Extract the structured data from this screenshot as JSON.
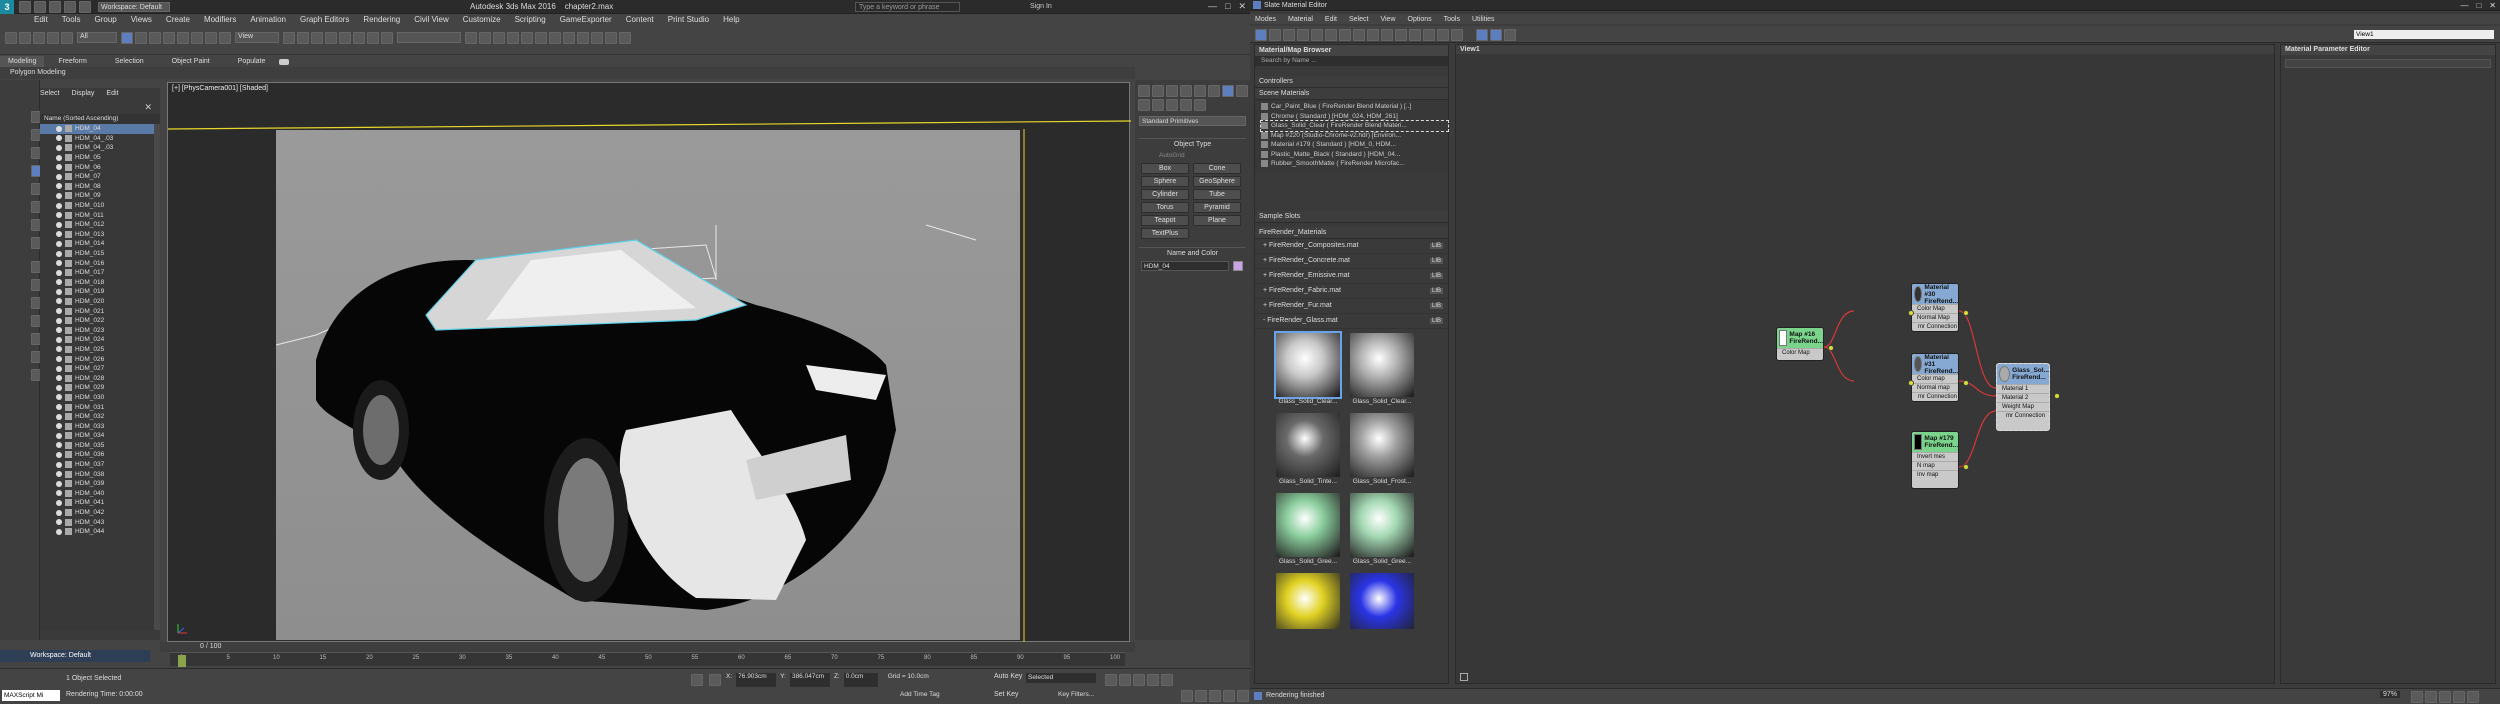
{
  "max": {
    "title": "Autodesk 3ds Max 2016",
    "file": "chapter2.max",
    "workspace": "Workspace: Default",
    "search_placeholder": "Type a keyword or phrase",
    "sign_in": "Sign In",
    "menu": [
      "Edit",
      "Tools",
      "Group",
      "Views",
      "Create",
      "Modifiers",
      "Animation",
      "Graph Editors",
      "Rendering",
      "Civil View",
      "Customize",
      "Scripting",
      "GameExporter",
      "Content",
      "Print Studio",
      "Help"
    ],
    "toolbar": {
      "selection_filter": "All",
      "view_dropdown": "View"
    },
    "ribbon_tabs": [
      "Modeling",
      "Freeform",
      "Selection",
      "Object Paint",
      "Populate"
    ],
    "ribbon_sub": "Polygon Modeling",
    "scene_explorer": {
      "tabs": [
        "Select",
        "Display",
        "Edit"
      ],
      "header": "Name (Sorted Ascending)",
      "items": [
        "HDM_04",
        "HDM_04_.03",
        "HDM_04_.03",
        "HDM_05",
        "HDM_06",
        "HDM_07",
        "HDM_08",
        "HDM_09",
        "HDM_010",
        "HDM_011",
        "HDM_012",
        "HDM_013",
        "HDM_014",
        "HDM_015",
        "HDM_016",
        "HDM_017",
        "HDM_018",
        "HDM_019",
        "HDM_020",
        "HDM_021",
        "HDM_022",
        "HDM_023",
        "HDM_024",
        "HDM_025",
        "HDM_026",
        "HDM_027",
        "HDM_028",
        "HDM_029",
        "HDM_030",
        "HDM_031",
        "HDM_032",
        "HDM_033",
        "HDM_034",
        "HDM_035",
        "HDM_036",
        "HDM_037",
        "HDM_038",
        "HDM_039",
        "HDM_040",
        "HDM_041",
        "HDM_042",
        "HDM_043",
        "HDM_044"
      ]
    },
    "viewport_label": "[+] [PhysCamera001] [Shaded]",
    "command_panel": {
      "category": "Standard Primitives",
      "object_type_title": "Object Type",
      "autogrid": "AutoGrid",
      "buttons": [
        "Box",
        "Cone",
        "Sphere",
        "GeoSphere",
        "Cylinder",
        "Tube",
        "Torus",
        "Pyramid",
        "Teapot",
        "Plane",
        "TextPlus"
      ],
      "name_color_title": "Name and Color",
      "name_value": "HDM_04"
    },
    "timeline": {
      "frame": "0 / 100",
      "ticks": [
        "0",
        "5",
        "10",
        "15",
        "20",
        "25",
        "30",
        "35",
        "40",
        "45",
        "50",
        "55",
        "60",
        "65",
        "70",
        "75",
        "80",
        "85",
        "90",
        "95",
        "100"
      ]
    },
    "status": {
      "selected": "1 Object Selected",
      "rendering_time": "Rendering Time: 0:00:00",
      "x": "76.903cm",
      "y": "386.047cm",
      "z": "0.0cm",
      "grid": "Grid = 10.0cm",
      "auto_key": "Auto Key",
      "set_key": "Set Key",
      "key_mode": "Selected",
      "key_filters": "Key Filters...",
      "add_time_tag": "Add Time Tag",
      "mini_listener": "MAXScript Mi"
    }
  },
  "sme": {
    "title": "Slate Material Editor",
    "menu": [
      "Modes",
      "Material",
      "Edit",
      "Select",
      "View",
      "Options",
      "Tools",
      "Utilities"
    ],
    "view_dropdown": "View1",
    "browser": {
      "title": "Material/Map Browser",
      "search_placeholder": "Search by Name ...",
      "sections": {
        "controllers": "Controllers",
        "scene": "Scene Materials",
        "sample": "Sample Slots",
        "fr": "FireRender_Materials"
      },
      "scene_materials": [
        "Car_Paint_Blue ( FireRender Blend Material ) [..]",
        "Chrome ( Standard ) [HDM_024, HDM_261]",
        "Glass_Solid_Clear ( FireRender Blend Materi...",
        "Map #220 (Studio-Chrome-v2.hdr) [Environ...",
        "Material #179 ( Standard ) [HDM_0, HDM...",
        "Plastic_Matte_Black ( Standard ) [HDM_04...",
        "Rubber_SmoothMatte ( FireRender Microfac..."
      ],
      "libs": [
        {
          "name": "+ FireRender_Composites.mat",
          "count": "LIB"
        },
        {
          "name": "+ FireRender_Concrete.mat",
          "count": "LIB"
        },
        {
          "name": "+ FireRender_Emissive.mat",
          "count": "LIB"
        },
        {
          "name": "+ FireRender_Fabric.mat",
          "count": "LIB"
        },
        {
          "name": "+ FireRender_Fur.mat",
          "count": "LIB"
        },
        {
          "name": "- FireRender_Glass.mat",
          "count": "LIB"
        }
      ],
      "thumbs": [
        {
          "label": "Glass_Solid_Clear...",
          "color": "#c8c8c8"
        },
        {
          "label": "Glass_Solid_Clear...",
          "color": "#b4b4b4"
        },
        {
          "label": "Glass_Solid_Tinte...",
          "color": "#6a6a6a"
        },
        {
          "label": "Glass_Solid_Frost...",
          "color": "#a0a0a0"
        },
        {
          "label": "Glass_Solid_Gree...",
          "color": "#8ccf9e"
        },
        {
          "label": "Glass_Solid_Gree...",
          "color": "#a3d8b3"
        },
        {
          "label": "Glass_Solid_Yello...",
          "color": "#e1d223"
        },
        {
          "label": "Glass_Solid_Blue...",
          "color": "#2a34e6"
        }
      ]
    },
    "view_title": "View1",
    "param_title": "Material Parameter Editor",
    "status": "Rendering finished",
    "zoom": "97%",
    "nodes": {
      "map16": {
        "title1": "Map #16",
        "title2": "FireRend...",
        "slots": [
          "Color Map"
        ]
      },
      "mat30": {
        "title1": "Material #30",
        "title2": "FireRend...",
        "slots": [
          "Color Map",
          "Normal Map",
          "mr Connection"
        ]
      },
      "mat31": {
        "title1": "Material #31",
        "title2": "FireRend...",
        "slots": [
          "Color map",
          "Normal map",
          "mr Connection"
        ]
      },
      "map179": {
        "title1": "Map #179",
        "title2": "FireRend...",
        "slots": [
          "Invert mes",
          "N map",
          "Inv map"
        ]
      },
      "glass": {
        "title1": "Glass_Sol...",
        "title2": "FireRend...",
        "slots": [
          "Material 1",
          "Material 2",
          "Weight Map",
          "mr Connection"
        ]
      }
    }
  }
}
